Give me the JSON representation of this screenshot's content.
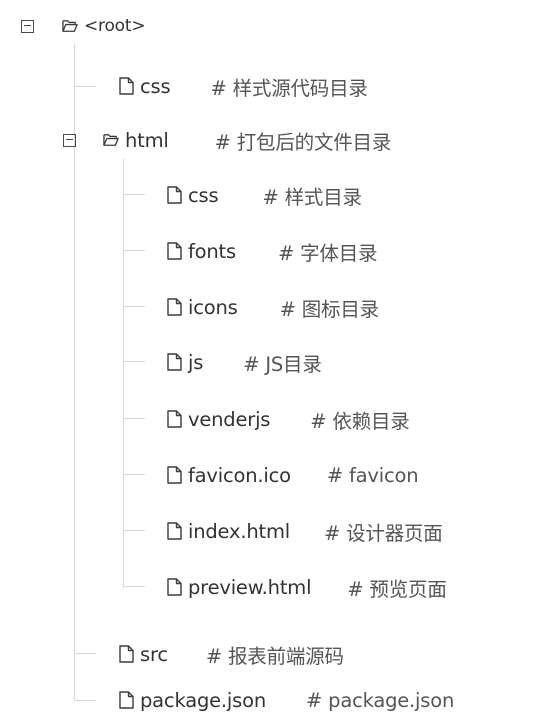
{
  "tree": {
    "root": {
      "name": "<root>",
      "expanded": true,
      "children": [
        {
          "name": "css",
          "comment": "# 样式源代码目录",
          "type": "file"
        },
        {
          "name": "html",
          "comment": "# 打包后的文件目录",
          "type": "folder",
          "expanded": true,
          "children": [
            {
              "name": "css",
              "comment": "# 样式目录",
              "type": "file"
            },
            {
              "name": "fonts",
              "comment": "# 字体目录",
              "type": "file"
            },
            {
              "name": "icons",
              "comment": "# 图标目录",
              "type": "file"
            },
            {
              "name": "js",
              "comment": "# JS目录",
              "type": "file"
            },
            {
              "name": "venderjs",
              "comment": "# 依赖目录",
              "type": "file"
            },
            {
              "name": "favicon.ico",
              "comment": "# favicon",
              "type": "file"
            },
            {
              "name": "index.html",
              "comment": "# 设计器页面",
              "type": "file"
            },
            {
              "name": "preview.html",
              "comment": "# 预览页面",
              "type": "file"
            }
          ]
        },
        {
          "name": "src",
          "comment": "# 报表前端源码",
          "type": "file"
        },
        {
          "name": "package.json",
          "comment": "# package.json",
          "type": "file"
        }
      ]
    }
  },
  "icons": {
    "folder": "folder-open-icon",
    "file": "file-icon",
    "toggle": "collapse-icon"
  },
  "colors": {
    "text": "#333333",
    "comment": "#555555",
    "guide": "#d7d7d7",
    "icon": "#3c3c3c"
  }
}
